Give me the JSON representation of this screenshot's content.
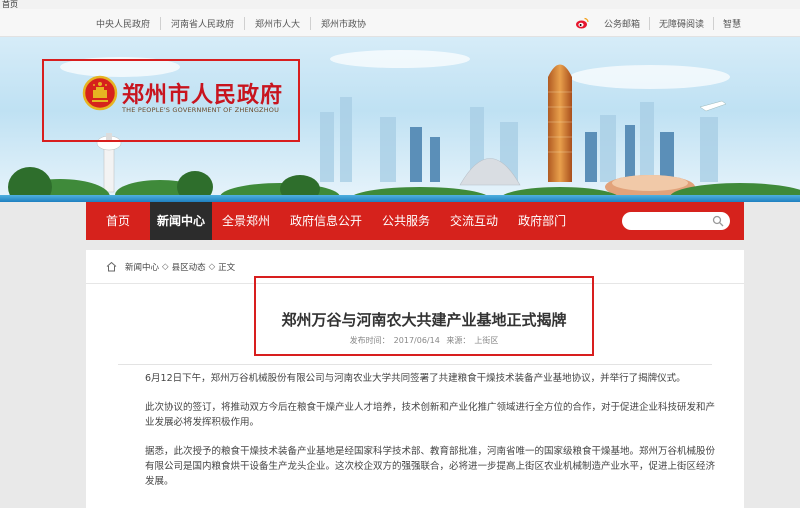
{
  "browser": {
    "tab_title": "首页"
  },
  "topbar": {
    "links": [
      "中央人民政府",
      "河南省人民政府",
      "郑州市人大",
      "郑州市政协"
    ],
    "right_links": [
      "公务邮箱",
      "无障碍阅读",
      "智慧"
    ]
  },
  "logo": {
    "cn": "郑州市人民政府",
    "en": "THE PEOPLE'S GOVERNMENT OF ZHENGZHOU"
  },
  "nav": {
    "items": [
      "首页",
      "新闻中心",
      "全景郑州",
      "政府信息公开",
      "公共服务",
      "交流互动",
      "政府部门"
    ],
    "active": "新闻中心",
    "search_placeholder": ""
  },
  "breadcrumb": [
    "新闻中心",
    "县区动态",
    "正文"
  ],
  "article": {
    "title": "郑州万谷与河南农大共建产业基地正式揭牌",
    "publish_label": "发布时间：",
    "publish_date": "2017/06/14",
    "source_label": "来源：",
    "source": "上街区",
    "paragraphs": [
      "6月12日下午，郑州万谷机械股份有限公司与河南农业大学共同签署了共建粮食干燥技术装备产业基地协议，并举行了揭牌仪式。",
      "此次协议的签订，将推动双方今后在粮食干燥产业人才培养，技术创新和产业化推广领域进行全方位的合作，对于促进企业科技研发和产业发展必将发挥积极作用。",
      "据悉，此次授予的粮食干燥技术装备产业基地是经国家科学技术部、教育部批准，河南省唯一的国家级粮食干燥基地。郑州万谷机械股份有限公司是国内粮食烘干设备生产龙头企业。这次校企双方的强强联合，必将进一步提高上街区农业机械制造产业水平，促进上街区经济发展。"
    ]
  },
  "colors": {
    "nav_red": "#d6221c",
    "nav_active": "#2c2c2c",
    "highlight_border": "#d81e1e",
    "logo_red": "#c8141e"
  }
}
